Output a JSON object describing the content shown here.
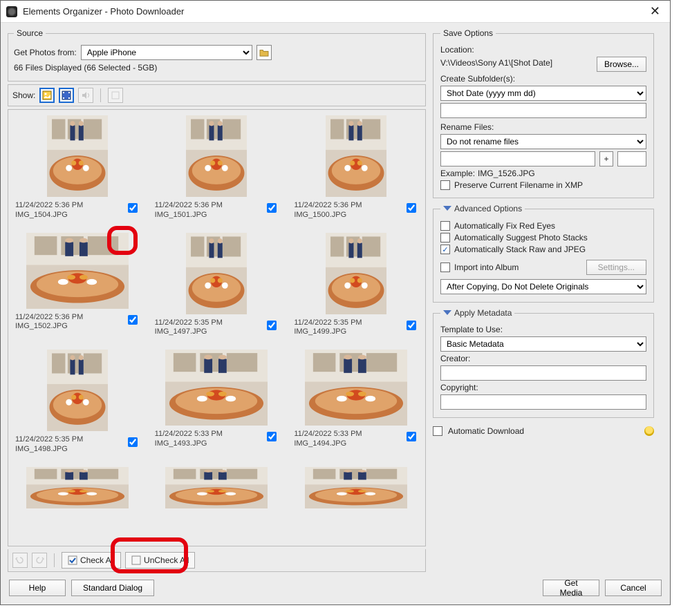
{
  "window": {
    "title": "Elements Organizer - Photo Downloader"
  },
  "source": {
    "legend": "Source",
    "get_from_label": "Get Photos from:",
    "device": "Apple iPhone",
    "count_line": "66 Files Displayed (66 Selected - 5GB)"
  },
  "showbar": {
    "label": "Show:"
  },
  "thumbs": [
    {
      "date": "11/24/2022 5:36 PM",
      "file": "IMG_1504.JPG",
      "orient": "portrait",
      "checked": true
    },
    {
      "date": "11/24/2022 5:36 PM",
      "file": "IMG_1501.JPG",
      "orient": "portrait",
      "checked": true
    },
    {
      "date": "11/24/2022 5:36 PM",
      "file": "IMG_1500.JPG",
      "orient": "portrait",
      "checked": true
    },
    {
      "date": "11/24/2022 5:36 PM",
      "file": "IMG_1502.JPG",
      "orient": "landscape",
      "checked": true
    },
    {
      "date": "11/24/2022 5:35 PM",
      "file": "IMG_1497.JPG",
      "orient": "portrait",
      "checked": true
    },
    {
      "date": "11/24/2022 5:35 PM",
      "file": "IMG_1499.JPG",
      "orient": "portrait",
      "checked": true
    },
    {
      "date": "11/24/2022 5:35 PM",
      "file": "IMG_1498.JPG",
      "orient": "portrait",
      "checked": true
    },
    {
      "date": "11/24/2022 5:33 PM",
      "file": "IMG_1493.JPG",
      "orient": "landscape",
      "checked": true
    },
    {
      "date": "11/24/2022 5:33 PM",
      "file": "IMG_1494.JPG",
      "orient": "landscape",
      "checked": true
    }
  ],
  "bottombar": {
    "check_all": "Check All",
    "uncheck_all": "UnCheck All"
  },
  "save": {
    "legend": "Save Options",
    "location_label": "Location:",
    "location_path": "V:\\Videos\\Sony A1\\[Shot Date]",
    "browse": "Browse...",
    "create_sub_label": "Create Subfolder(s):",
    "create_sub_value": "Shot Date (yyyy mm dd)",
    "rename_label": "Rename Files:",
    "rename_value": "Do not rename files",
    "plus": "+",
    "example_label": "Example:",
    "example_value": "IMG_1526.JPG",
    "preserve_xmp": "Preserve Current Filename in XMP"
  },
  "advanced": {
    "legend": "Advanced Options",
    "fix_red_eyes": "Automatically Fix Red Eyes",
    "suggest_stacks": "Automatically Suggest Photo Stacks",
    "stack_raw_jpeg": "Automatically Stack Raw and JPEG",
    "import_album": "Import into Album",
    "settings": "Settings...",
    "after_copy": "After Copying, Do Not Delete Originals"
  },
  "metadata": {
    "legend": "Apply Metadata",
    "template_label": "Template to Use:",
    "template_value": "Basic Metadata",
    "creator_label": "Creator:",
    "copyright_label": "Copyright:"
  },
  "auto_dl": {
    "label": "Automatic Download"
  },
  "footer": {
    "help": "Help",
    "std_dialog": "Standard Dialog",
    "get_media": "Get Media",
    "cancel": "Cancel"
  }
}
